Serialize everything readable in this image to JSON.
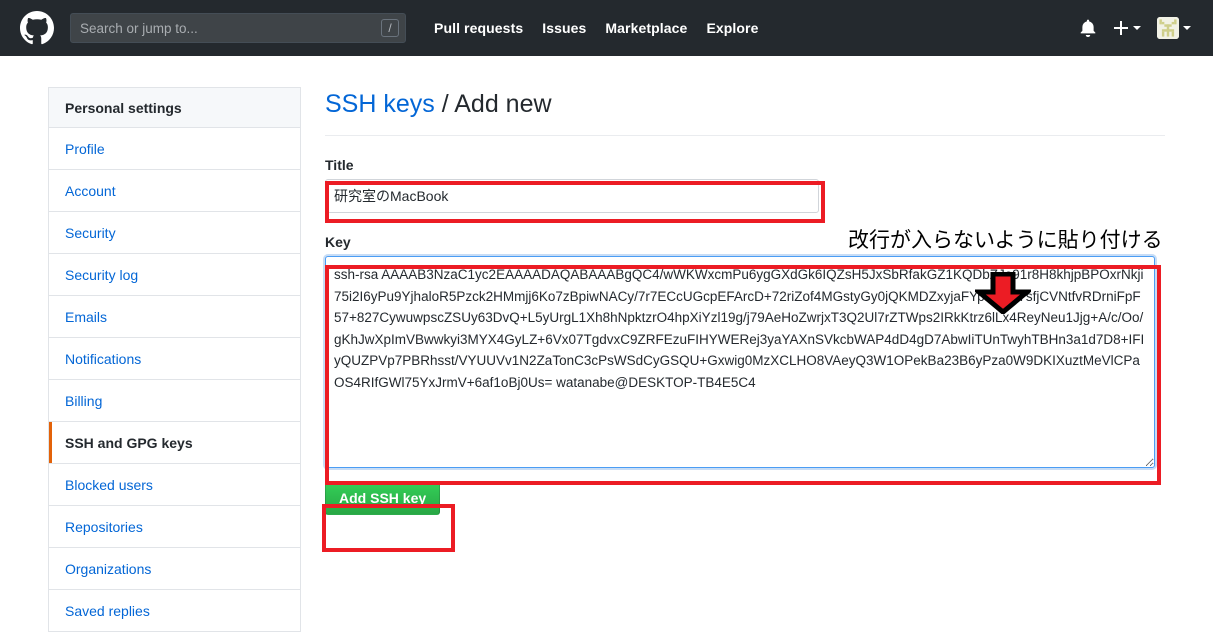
{
  "header": {
    "logo_icon": "github-mark-icon",
    "search": {
      "placeholder": "Search or jump to...",
      "value": "",
      "shortcut_badge": "/"
    },
    "nav": [
      {
        "label": "Pull requests"
      },
      {
        "label": "Issues"
      },
      {
        "label": "Marketplace"
      },
      {
        "label": "Explore"
      }
    ],
    "right": {
      "notifications_icon": "bell-icon",
      "create_new_icon": "plus-icon",
      "avatar_icon": "user-avatar-identicon"
    },
    "background_color": "#24292e"
  },
  "sidebar": {
    "heading": "Personal settings",
    "items": [
      {
        "label": "Profile",
        "selected": false
      },
      {
        "label": "Account",
        "selected": false
      },
      {
        "label": "Security",
        "selected": false
      },
      {
        "label": "Security log",
        "selected": false
      },
      {
        "label": "Emails",
        "selected": false
      },
      {
        "label": "Notifications",
        "selected": false
      },
      {
        "label": "Billing",
        "selected": false
      },
      {
        "label": "SSH and GPG keys",
        "selected": true
      },
      {
        "label": "Blocked users",
        "selected": false
      },
      {
        "label": "Repositories",
        "selected": false
      },
      {
        "label": "Organizations",
        "selected": false
      },
      {
        "label": "Saved replies",
        "selected": false
      }
    ],
    "selected_accent_color": "#e36209",
    "link_color": "#0366d6"
  },
  "main": {
    "title_link": "SSH keys",
    "title_separator": "/",
    "title_current": "Add new",
    "title_field": {
      "label": "Title",
      "value": "研究室のMacBook"
    },
    "key_field": {
      "label": "Key",
      "value": "ssh-rsa AAAAB3NzaC1yc2EAAAADAQABAAABgQC4/wWKWxcmPu6ygGXdGk6IQZsH5JxSbRfakGZ1KQDbZJo91r8H8khjpBPOxrNkji75i2I6yPu9YjhaloR5Pzck2HMmjj6Ko7zBpiwNACy/7r7ECcUGcpEFArcD+72riZof4MGstyGy0jQKMDZxyjaFYpF5Gn7sfjCVNtfvRDrniFpF57+827CywuwpscZSUy63DvQ+L5yUrgL1Xh8hNpktzrO4hpXiYzl19g/j79AeHoZwrjxT3Q2Ul7rZTWps2IRkKtrz6lLx4ReyNeu1Jjg+A/c/Oo/gKhJwXpImVBwwkyi3MYX4GyLZ+6Vx07TgdvxC9ZRFEzuFIHYWERej3yaYAXnSVkcbWAP4dD4gD7AbwIiTUnTwyhTBHn3a1d7D8+IFIyQUZPVp7PBRhsst/VYUUVv1N2ZaTonC3cPsWSdCyGSQU+Gxwig0MzXCLHO8VAeyQ3W1OPekBa23B6yPza0W9DKIXuztMeVlCPaOS4RIfGWl75YxJrmV+6af1oBj0Us= watanabe@DESKTOP-TB4E5C4"
    },
    "submit_button": "Add SSH key",
    "submit_button_color": "#28a745"
  },
  "annotations": {
    "note_text": "改行が入らないように貼り付ける",
    "arrow_icon": "down-arrow-icon",
    "highlight_color": "#ec1c24",
    "arrow_fill": "#ec1c24",
    "arrow_stroke": "#000000"
  }
}
